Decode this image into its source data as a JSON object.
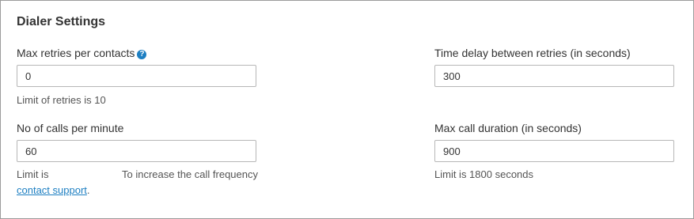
{
  "panel": {
    "title": "Dialer Settings"
  },
  "fields": {
    "max_retries": {
      "label": "Max retries per contacts",
      "value": "0",
      "hint": "Limit of retries is 10",
      "help_icon": "question-circle"
    },
    "time_delay": {
      "label": "Time delay between retries (in seconds)",
      "value": "300"
    },
    "calls_per_minute": {
      "label": "No of calls per minute",
      "value": "60",
      "hint_prefix": "Limit is",
      "hint_suffix": "To increase the call frequency",
      "link_text": "contact support",
      "link_tail": "."
    },
    "max_call_duration": {
      "label": "Max call duration (in seconds)",
      "value": "900",
      "hint": "Limit is 1800 seconds"
    }
  },
  "colors": {
    "accent": "#1d7fc2",
    "border": "#9b9b9b",
    "text": "#333333"
  }
}
